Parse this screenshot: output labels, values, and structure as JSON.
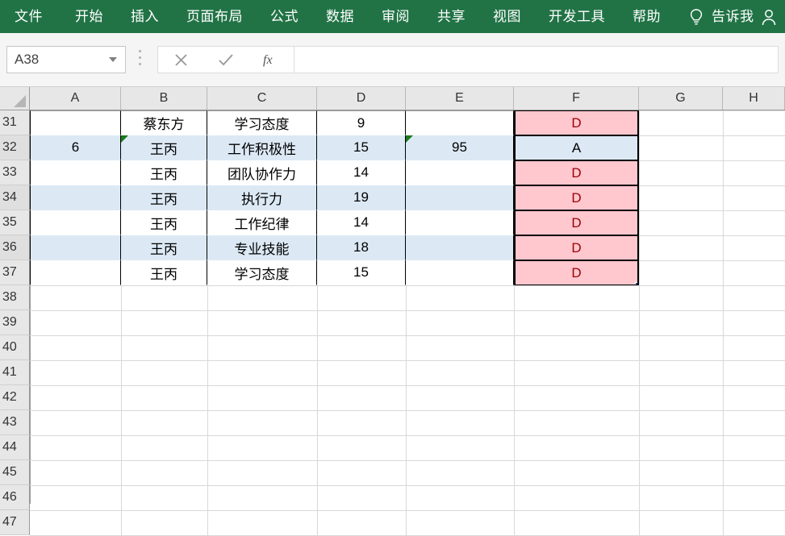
{
  "ribbon": {
    "tabs": [
      {
        "label": "文件",
        "name": "ribbon-tab-file"
      },
      {
        "label": "开始",
        "name": "ribbon-tab-home"
      },
      {
        "label": "插入",
        "name": "ribbon-tab-insert"
      },
      {
        "label": "页面布局",
        "name": "ribbon-tab-page-layout"
      },
      {
        "label": "公式",
        "name": "ribbon-tab-formulas"
      },
      {
        "label": "数据",
        "name": "ribbon-tab-data"
      },
      {
        "label": "审阅",
        "name": "ribbon-tab-review"
      },
      {
        "label": "共享",
        "name": "ribbon-tab-share"
      },
      {
        "label": "视图",
        "name": "ribbon-tab-view"
      },
      {
        "label": "开发工具",
        "name": "ribbon-tab-developer"
      },
      {
        "label": "帮助",
        "name": "ribbon-tab-help"
      }
    ],
    "tell_me": "告诉我",
    "bulb_icon": "lightbulb-icon",
    "account_icon": "account-icon",
    "background_color": "#217346"
  },
  "formula_bar": {
    "name_box_value": "A38",
    "name_box_caret": "chevron-down-icon",
    "cancel_icon": "cancel-x-icon",
    "confirm_icon": "confirm-check-icon",
    "function_icon": "insert-function-fx-icon",
    "formula_value": "",
    "formula_placeholder": ""
  },
  "grid": {
    "columns": [
      "A",
      "B",
      "C",
      "D",
      "E",
      "F",
      "G",
      "H"
    ],
    "rows": [
      "31",
      "32",
      "33",
      "34",
      "35",
      "36",
      "37",
      "38",
      "39",
      "40",
      "41",
      "42",
      "43",
      "44",
      "45",
      "46",
      "47"
    ],
    "selected_cell": "A38",
    "banded_rows": [
      "32",
      "34",
      "36"
    ],
    "colors": {
      "bad_fill": "#ffc7ce",
      "bad_text": "#9c0006",
      "band_fill": "#dce9f5",
      "header_fill": "#e7e7e7",
      "accent_green": "#217346",
      "fill_handle": "#1f3f9e"
    },
    "cells": [
      {
        "row": "31",
        "A": "",
        "B": "蔡东方",
        "C": "学习态度",
        "D": "9",
        "E": "",
        "F": "D",
        "f_style": "bad"
      },
      {
        "row": "32",
        "A": "6",
        "B": "王丙",
        "C": "工作积极性",
        "D": "15",
        "E": "95",
        "F": "A",
        "f_style": "normal",
        "comment_flags": [
          "B",
          "E"
        ]
      },
      {
        "row": "33",
        "A": "",
        "B": "王丙",
        "C": "团队协作力",
        "D": "14",
        "E": "",
        "F": "D",
        "f_style": "bad"
      },
      {
        "row": "34",
        "A": "",
        "B": "王丙",
        "C": "执行力",
        "D": "19",
        "E": "",
        "F": "D",
        "f_style": "bad"
      },
      {
        "row": "35",
        "A": "",
        "B": "王丙",
        "C": "工作纪律",
        "D": "14",
        "E": "",
        "F": "D",
        "f_style": "bad"
      },
      {
        "row": "36",
        "A": "",
        "B": "王丙",
        "C": "专业技能",
        "D": "18",
        "E": "",
        "F": "D",
        "f_style": "bad"
      },
      {
        "row": "37",
        "A": "",
        "B": "王丙",
        "C": "学习态度",
        "D": "15",
        "E": "",
        "F": "D",
        "f_style": "bad"
      },
      {
        "row": "38",
        "A": "",
        "B": "",
        "C": "",
        "D": "",
        "E": "",
        "F": ""
      },
      {
        "row": "39",
        "A": "",
        "B": "",
        "C": "",
        "D": "",
        "E": "",
        "F": ""
      },
      {
        "row": "40",
        "A": "",
        "B": "",
        "C": "",
        "D": "",
        "E": "",
        "F": ""
      },
      {
        "row": "41",
        "A": "",
        "B": "",
        "C": "",
        "D": "",
        "E": "",
        "F": ""
      },
      {
        "row": "42",
        "A": "",
        "B": "",
        "C": "",
        "D": "",
        "E": "",
        "F": ""
      },
      {
        "row": "43",
        "A": "",
        "B": "",
        "C": "",
        "D": "",
        "E": "",
        "F": ""
      },
      {
        "row": "44",
        "A": "",
        "B": "",
        "C": "",
        "D": "",
        "E": "",
        "F": ""
      },
      {
        "row": "45",
        "A": "",
        "B": "",
        "C": "",
        "D": "",
        "E": "",
        "F": ""
      },
      {
        "row": "46",
        "A": "",
        "B": "",
        "C": "",
        "D": "",
        "E": "",
        "F": ""
      },
      {
        "row": "47",
        "A": "",
        "B": "",
        "C": "",
        "D": "",
        "E": "",
        "F": ""
      }
    ]
  }
}
